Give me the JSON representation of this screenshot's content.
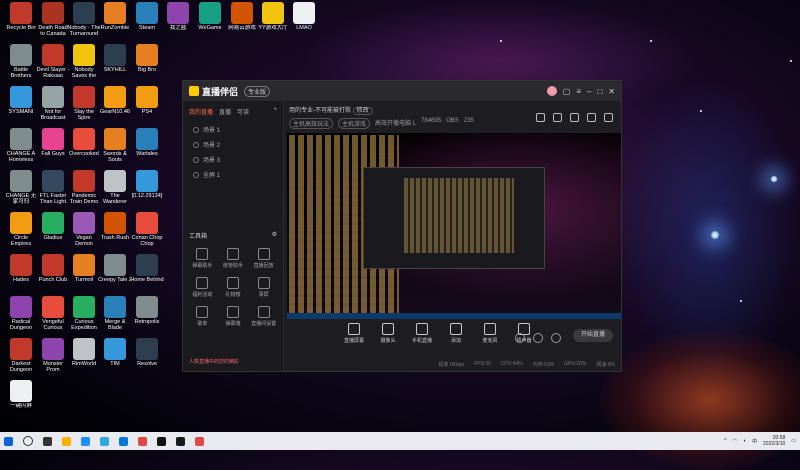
{
  "desktop": {
    "icons": [
      {
        "label": "Recycle Bin",
        "color": "#c0392b"
      },
      {
        "label": "Death Road to Canada",
        "color": "#aa3322"
      },
      {
        "label": "Nobody - The Turnaround",
        "color": "#2c3e50"
      },
      {
        "label": "RunZombie",
        "color": "#e67e22"
      },
      {
        "label": "Steam",
        "color": "#2980b9"
      },
      {
        "label": "我之盐",
        "color": "#8e44ad"
      },
      {
        "label": "WeGame",
        "color": "#16a085"
      },
      {
        "label": "网易云游戏",
        "color": "#d35400"
      },
      {
        "label": "YY游戏大厅",
        "color": "#f1c40f"
      },
      {
        "label": "LMAO",
        "color": "#ecf0f1"
      },
      {
        "label": "Battle Brothers",
        "color": "#7f8c8d"
      },
      {
        "label": "Devil Slayer - Raksasi",
        "color": "#c0392b"
      },
      {
        "label": "Nobody Saves the World",
        "color": "#f1c40f"
      },
      {
        "label": "SKYHILL",
        "color": "#2c3e50"
      },
      {
        "label": "Big Bro",
        "color": "#e67e22"
      },
      {
        "label": "SYSMANI",
        "color": "#3498db"
      },
      {
        "label": "Not for Broadcast",
        "color": "#95a5a6"
      },
      {
        "label": "Slay the Spire",
        "color": "#c0392b"
      },
      {
        "label": "GearN10.46",
        "color": "#f39c12"
      },
      {
        "label": "PS4",
        "color": "#f39c12"
      },
      {
        "label": "CHANGE A Homeless",
        "color": "#7f8c8d"
      },
      {
        "label": "Fall Guys",
        "color": "#e84393"
      },
      {
        "label": "Overcooked",
        "color": "#e74c3c"
      },
      {
        "label": "Swords & Souls",
        "color": "#e67e22"
      },
      {
        "label": "Wartales",
        "color": "#2980b9"
      },
      {
        "label": "CHANGE 无家可归",
        "color": "#7f8c8d"
      },
      {
        "label": "FTL Faster Than Light",
        "color": "#34495e"
      },
      {
        "label": "Pandemic Train Demo",
        "color": "#c0392b"
      },
      {
        "label": "The Wanderer",
        "color": "#bdc3c7"
      },
      {
        "label": "[0.12.29134]",
        "color": "#3498db"
      },
      {
        "label": "Circle Empires",
        "color": "#f39c12"
      },
      {
        "label": "Gladius",
        "color": "#27ae60"
      },
      {
        "label": "Vegan Demon",
        "color": "#9b59b6"
      },
      {
        "label": "Trash Rush",
        "color": "#d35400"
      },
      {
        "label": "Conan Chop Chop",
        "color": "#e74c3c"
      },
      {
        "label": "Hades",
        "color": "#c0392b"
      },
      {
        "label": "Punch Club",
        "color": "#c0392b"
      },
      {
        "label": "Turmoil",
        "color": "#e67e22"
      },
      {
        "label": "Creepy Tale 2",
        "color": "#7f8c8d"
      },
      {
        "label": "Home Behind",
        "color": "#2c3e50"
      },
      {
        "label": "Radical Dungeon",
        "color": "#8e44ad"
      },
      {
        "label": "Vengeful Curious",
        "color": "#e74c3c"
      },
      {
        "label": "Curious Expedition",
        "color": "#27ae60"
      },
      {
        "label": "Merge & Blade",
        "color": "#2980b9"
      },
      {
        "label": "Retropolis",
        "color": "#7f8c8d"
      },
      {
        "label": "Darkest Dungeon",
        "color": "#c0392b"
      },
      {
        "label": "Monster Prom",
        "color": "#8e44ad"
      },
      {
        "label": "RimWorld",
        "color": "#bdc3c7"
      },
      {
        "label": "TIM",
        "color": "#3498db"
      },
      {
        "label": "Resolve",
        "color": "#2c3e50"
      },
      {
        "label": "一键闪屏",
        "color": "#ecf0f1"
      }
    ]
  },
  "app": {
    "title": "直播伴侣",
    "badge": "专业版",
    "window_controls": [
      "minimize",
      "maximize",
      "close"
    ],
    "left_tabs": [
      "我的直播",
      "直播",
      "可读"
    ],
    "scenes": [
      "场景 1",
      "场景 2",
      "场景 3",
      "全屏 1"
    ],
    "tools_title": "工具箱",
    "tools": [
      "弹幕助手",
      "房管助手",
      "直播回放",
      "福利活动",
      "礼物榜",
      "录屏",
      "歌单",
      "弹幕墙",
      "直播间设置"
    ],
    "notice": "人数直播中的您的精彩",
    "stream_title": "用的专业-不可能被打败",
    "stream_badge": "修改",
    "stream_sub": [
      "主机高效玩法",
      "主机游戏",
      "高效开播电脑 L",
      "784695",
      "OBS",
      "235"
    ],
    "bottom_controls": [
      "直播屏幕",
      "摄像头",
      "手机直播",
      "添加",
      "麦克风",
      "扬声器"
    ],
    "start_button": "开始直播",
    "status": [
      "码率 0Kbps",
      "FPS:30",
      "CPU:44%",
      "内存:53%",
      "GPU:26%",
      "网速:0%"
    ]
  },
  "taskbar": {
    "time": "20:58",
    "date": "2022/3/10",
    "tray": [
      "英",
      "中"
    ]
  }
}
